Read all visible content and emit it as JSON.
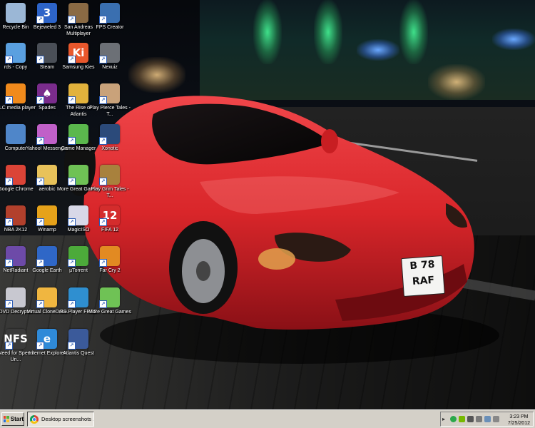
{
  "desktop_icons": [
    {
      "label": "Recycle Bin",
      "icon": "recycle-bin-icon",
      "color": "#9bb7d6"
    },
    {
      "label": "Bejeweled 3",
      "icon": "bejeweled-icon",
      "color": "#2d64c8",
      "glyph": "3"
    },
    {
      "label": "San Andreas Multiplayer",
      "icon": "san-andreas-icon",
      "color": "#8a6a44"
    },
    {
      "label": "FPS Creator",
      "icon": "fps-creator-icon",
      "color": "#3a6fb0"
    },
    {
      "label": "rds - Copy",
      "icon": "network-icon",
      "color": "#5aa0e0"
    },
    {
      "label": "Steam",
      "icon": "steam-icon",
      "color": "#4a4f57"
    },
    {
      "label": "Samsung Kies",
      "icon": "samsung-kies-icon",
      "color": "#e9572c",
      "glyph": "Ki"
    },
    {
      "label": "Nexuiz",
      "icon": "nexuiz-icon",
      "color": "#6c7076"
    },
    {
      "label": "VLC media player",
      "icon": "vlc-icon",
      "color": "#f08a1c"
    },
    {
      "label": "Spades",
      "icon": "spades-icon",
      "color": "#7a2c8c",
      "glyph": "♠"
    },
    {
      "label": "The Rise of Atlantis",
      "icon": "rise-of-atlantis-icon",
      "color": "#e2b23c"
    },
    {
      "label": "Play Pierce Tales - T...",
      "icon": "pierce-tales-icon",
      "color": "#c9a27a"
    },
    {
      "label": "Computer",
      "icon": "computer-icon",
      "color": "#4f86c9"
    },
    {
      "label": "Yahoo! Messenger",
      "icon": "yahoo-messenger-icon",
      "color": "#c060c8"
    },
    {
      "label": "Game Manager",
      "icon": "game-manager-icon",
      "color": "#5bb84d"
    },
    {
      "label": "Xonotic",
      "icon": "xonotic-icon",
      "color": "#2b4a7a"
    },
    {
      "label": "Google Chrome",
      "icon": "chrome-icon",
      "color": "#db4437"
    },
    {
      "label": "aerobic",
      "icon": "folder-icon",
      "color": "#e8c25a"
    },
    {
      "label": "More Great Games",
      "icon": "more-great-games-icon",
      "color": "#6fc255"
    },
    {
      "label": "Play Grim Tales - T...",
      "icon": "grim-tales-icon",
      "color": "#a8813d"
    },
    {
      "label": "NBA 2K12",
      "icon": "nba-2k12-icon",
      "color": "#b2402c"
    },
    {
      "label": "Winamp",
      "icon": "winamp-icon",
      "color": "#e6a21a"
    },
    {
      "label": "MagicISO",
      "icon": "magiciso-icon",
      "color": "#d8d8e8"
    },
    {
      "label": "FIFA 12",
      "icon": "fifa12-icon",
      "color": "#d42c2c",
      "glyph": "12"
    },
    {
      "label": "NetRadiant",
      "icon": "netradiant-icon",
      "color": "#6d4aa8"
    },
    {
      "label": "Google Earth",
      "icon": "google-earth-icon",
      "color": "#2f67c7"
    },
    {
      "label": "µTorrent",
      "icon": "utorrent-icon",
      "color": "#4caa3a"
    },
    {
      "label": "Far Cry 2",
      "icon": "far-cry-2-icon",
      "color": "#e28a22"
    },
    {
      "label": "DVD Decrypter",
      "icon": "dvd-decrypter-icon",
      "color": "#c8c8d0"
    },
    {
      "label": "Virtual CloneDrive",
      "icon": "virtual-clonedrive-icon",
      "color": "#f0b640"
    },
    {
      "label": "BS.Player FREE",
      "icon": "bsplayer-icon",
      "color": "#2f8fd0"
    },
    {
      "label": "More Great Games",
      "icon": "more-great-games-icon",
      "color": "#6fc255"
    },
    {
      "label": "Need for Speed Un...",
      "icon": "need-for-speed-icon",
      "color": "#3a3a3a",
      "glyph": "NFS"
    },
    {
      "label": "Internet Explorer",
      "icon": "internet-explorer-icon",
      "color": "#2f8ad8",
      "glyph": "e"
    },
    {
      "label": "Atlantis Quest",
      "icon": "atlantis-quest-icon",
      "color": "#3b5a9a"
    }
  ],
  "taskbar": {
    "start_label": "Start",
    "task_label": "Desktop screenshots ...",
    "clock_time": "3:23 PM",
    "clock_date": "7/25/2012"
  },
  "license_plate": {
    "line1": "B 78",
    "line2": "RAF"
  },
  "colors": {
    "taskbar": "#d4d0c8",
    "car_red": "#d9262a"
  }
}
